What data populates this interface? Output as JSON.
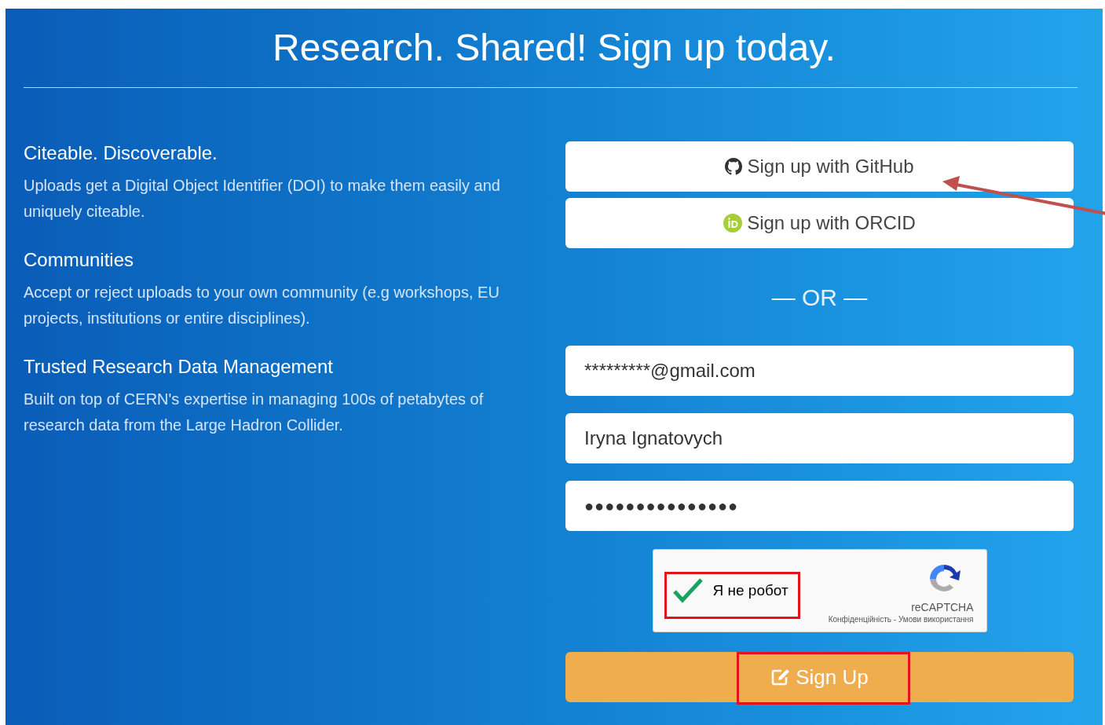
{
  "title": "Research. Shared! Sign up today.",
  "features": [
    {
      "heading": "Citeable. Discoverable.",
      "text": "Uploads get a Digital Object Identifier (DOI) to make them easily and uniquely citeable."
    },
    {
      "heading": "Communities",
      "text": "Accept or reject uploads to your own community (e.g workshops, EU projects, institutions or entire disciplines)."
    },
    {
      "heading": "Trusted Research Data Management",
      "text": "Built on top of CERN's expertise in managing 100s of petabytes of research data from the Large Hadron Collider."
    }
  ],
  "oauth_buttons": [
    {
      "kind": "github",
      "label": "Sign up with GitHub",
      "pointed": true
    },
    {
      "kind": "orcid",
      "label": "Sign up with ORCID",
      "pointed": false
    }
  ],
  "separator": "— OR —",
  "fields": [
    {
      "kind": "email",
      "value": "*********@gmail.com"
    },
    {
      "kind": "text",
      "value": "Iryna Ignatovych"
    },
    {
      "kind": "password",
      "value": "●●●●●●●●●●●●●●●"
    }
  ],
  "captcha": {
    "checked": true,
    "highlighted": true,
    "label": "Я не робот",
    "brand": "reCAPTCHA",
    "links": "Конфіденційність - Умови використання"
  },
  "submit": {
    "label": "Sign Up",
    "highlighted": true
  }
}
